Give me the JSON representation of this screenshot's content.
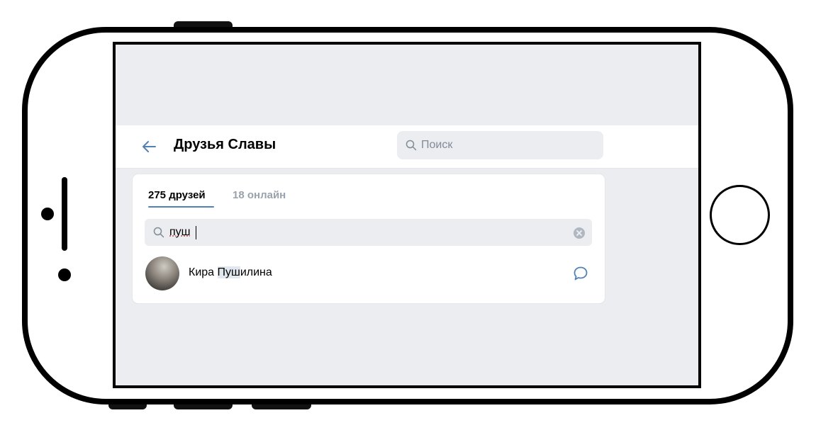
{
  "header": {
    "title": "Друзья Славы",
    "search_placeholder": "Поиск"
  },
  "tabs": [
    {
      "label": "275 друзей",
      "active": true
    },
    {
      "label": "18 онлайн",
      "active": false
    }
  ],
  "friend_search": {
    "value": "пуш"
  },
  "results": [
    {
      "name_prefix": "Кира ",
      "name_match": "Пуш",
      "name_suffix": "илина"
    }
  ],
  "colors": {
    "accent": "#5181b8",
    "background": "#ebedf0",
    "muted_text": "#99a2ad"
  },
  "icons": {
    "back": "arrow-left-icon",
    "search": "search-icon",
    "clear": "clear-icon",
    "message": "message-bubble-icon"
  }
}
